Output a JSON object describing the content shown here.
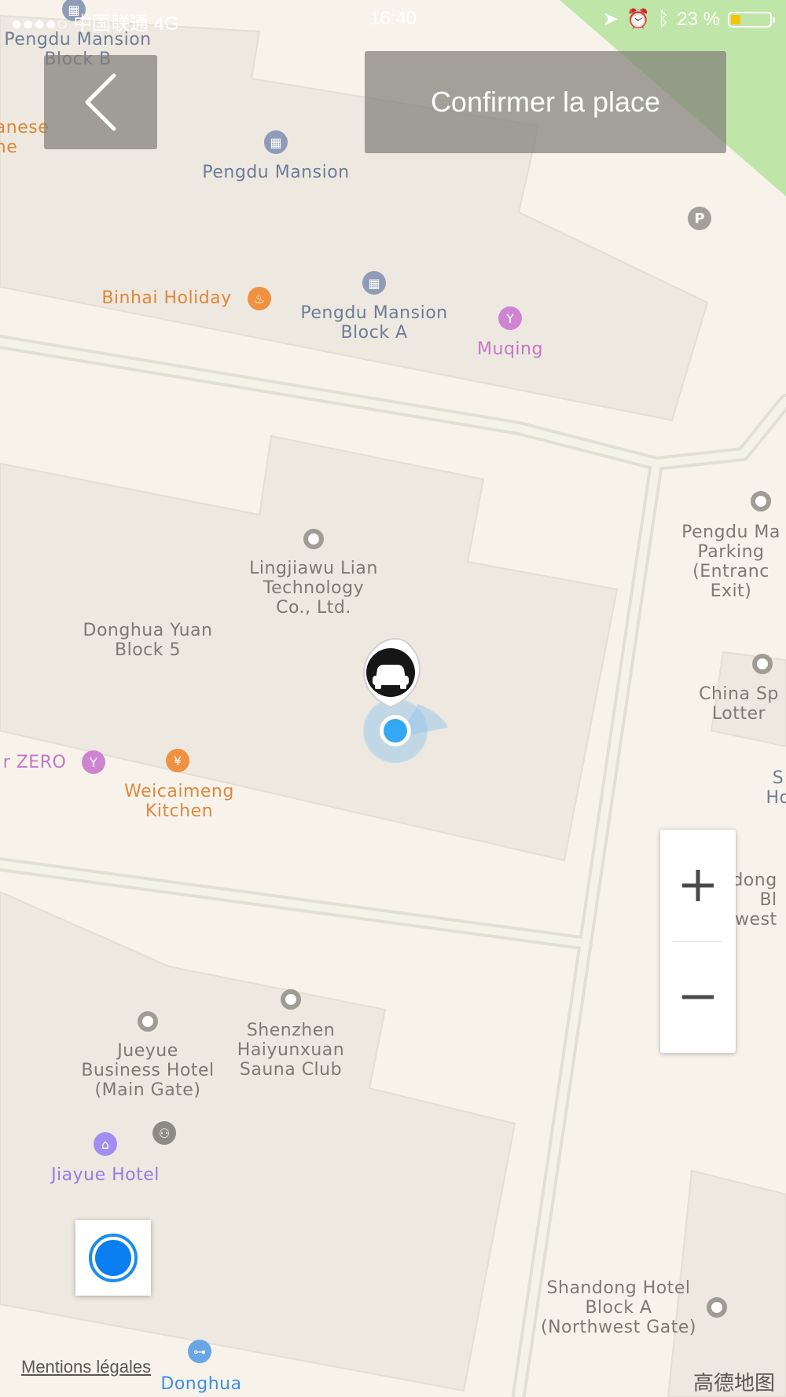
{
  "status_bar": {
    "carrier": "●●●●○ 中国联通  4G",
    "time": "16:40",
    "battery": "23 %"
  },
  "header": {
    "confirm_label": "Confirmer la place"
  },
  "map_labels": {
    "pengdu_b": "Pengdu Mansion\nBlock B",
    "japanese": "anese\nne",
    "pengdu": "Pengdu Mansion",
    "binhai": "Binhai Holiday",
    "pengdu_a": "Pengdu Mansion\nBlock A",
    "muqing": "Muqing",
    "lingjiawu": "Lingjiawu Lian\nTechnology\nCo., Ltd.",
    "donghua5": "Donghua Yuan\nBlock 5",
    "zero": "r ZERO",
    "weicaimeng": "Weicaimeng\nKitchen",
    "pengdu_parking": "Pengdu Ma\nParking\n(Entranc\nExit)",
    "china_sports": "China Sp\nLotter",
    "s_ho": "S\nHo",
    "dong_west": "dong\nBl\nwest",
    "jueyue": "Jueyue\nBusiness Hotel\n(Main Gate)",
    "shenzhen_sauna": "Shenzhen\nHaiyunxuan\nSauna Club",
    "jiayue": "Jiayue Hotel",
    "shandong": "Shandong Hotel\nBlock A\n(Northwest Gate)",
    "donghua": "Donghua"
  },
  "footer": {
    "legal": "Mentions légales",
    "logo": "高德地图"
  },
  "icons": {
    "back": "chevron-left-icon",
    "car": "car-icon",
    "zoom_in": "plus-icon",
    "zoom_out": "minus-icon",
    "locate": "locate-icon"
  },
  "colors": {
    "map_bg": "#f7f3eb",
    "building": "#ede8e0",
    "road": "#e2e4d6",
    "park": "#bfe6a8",
    "location": "#35a8f4"
  }
}
